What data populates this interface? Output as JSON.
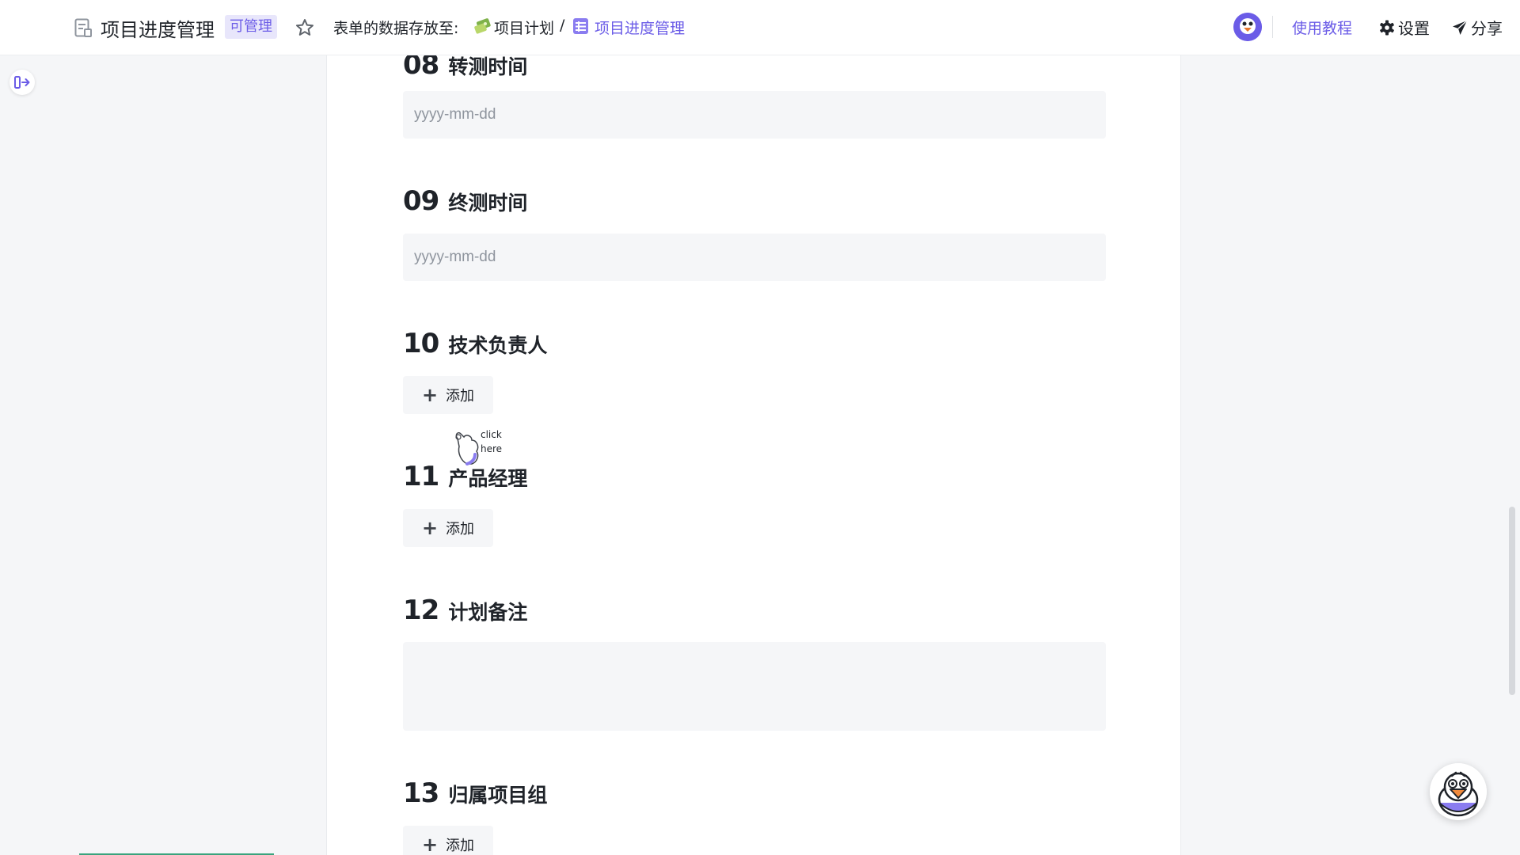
{
  "header": {
    "title": "项目进度管理",
    "permission_badge": "可管理",
    "store_label": "表单的数据存放至:",
    "breadcrumb": {
      "folder": "项目计划",
      "separator": "/",
      "current": "项目进度管理"
    },
    "tutorial_link": "使用教程",
    "settings_label": "设置",
    "share_label": "分享"
  },
  "form": {
    "questions": [
      {
        "number": "08",
        "label": "转测时间",
        "type": "date",
        "placeholder": "yyyy-mm-dd"
      },
      {
        "number": "09",
        "label": "终测时间",
        "type": "date",
        "placeholder": "yyyy-mm-dd"
      },
      {
        "number": "10",
        "label": "技术负责人",
        "type": "member",
        "add_label": "添加"
      },
      {
        "number": "11",
        "label": "产品经理",
        "type": "member",
        "add_label": "添加"
      },
      {
        "number": "12",
        "label": "计划备注",
        "type": "text"
      },
      {
        "number": "13",
        "label": "归属项目组",
        "type": "member",
        "add_label": "添加"
      }
    ]
  },
  "cursor_hint": {
    "line1": "click",
    "line2": "here"
  },
  "colors": {
    "accent": "#6b5ce7",
    "field_bg": "#f5f6f8",
    "text": "#1f2329"
  },
  "icons": {
    "doc": "document-icon",
    "star": "star-icon",
    "folder": "folder-icon",
    "table": "table-icon",
    "settings": "gear-icon",
    "share": "send-icon",
    "sidebar_toggle": "sidebar-expand-icon",
    "plus": "plus-icon"
  }
}
